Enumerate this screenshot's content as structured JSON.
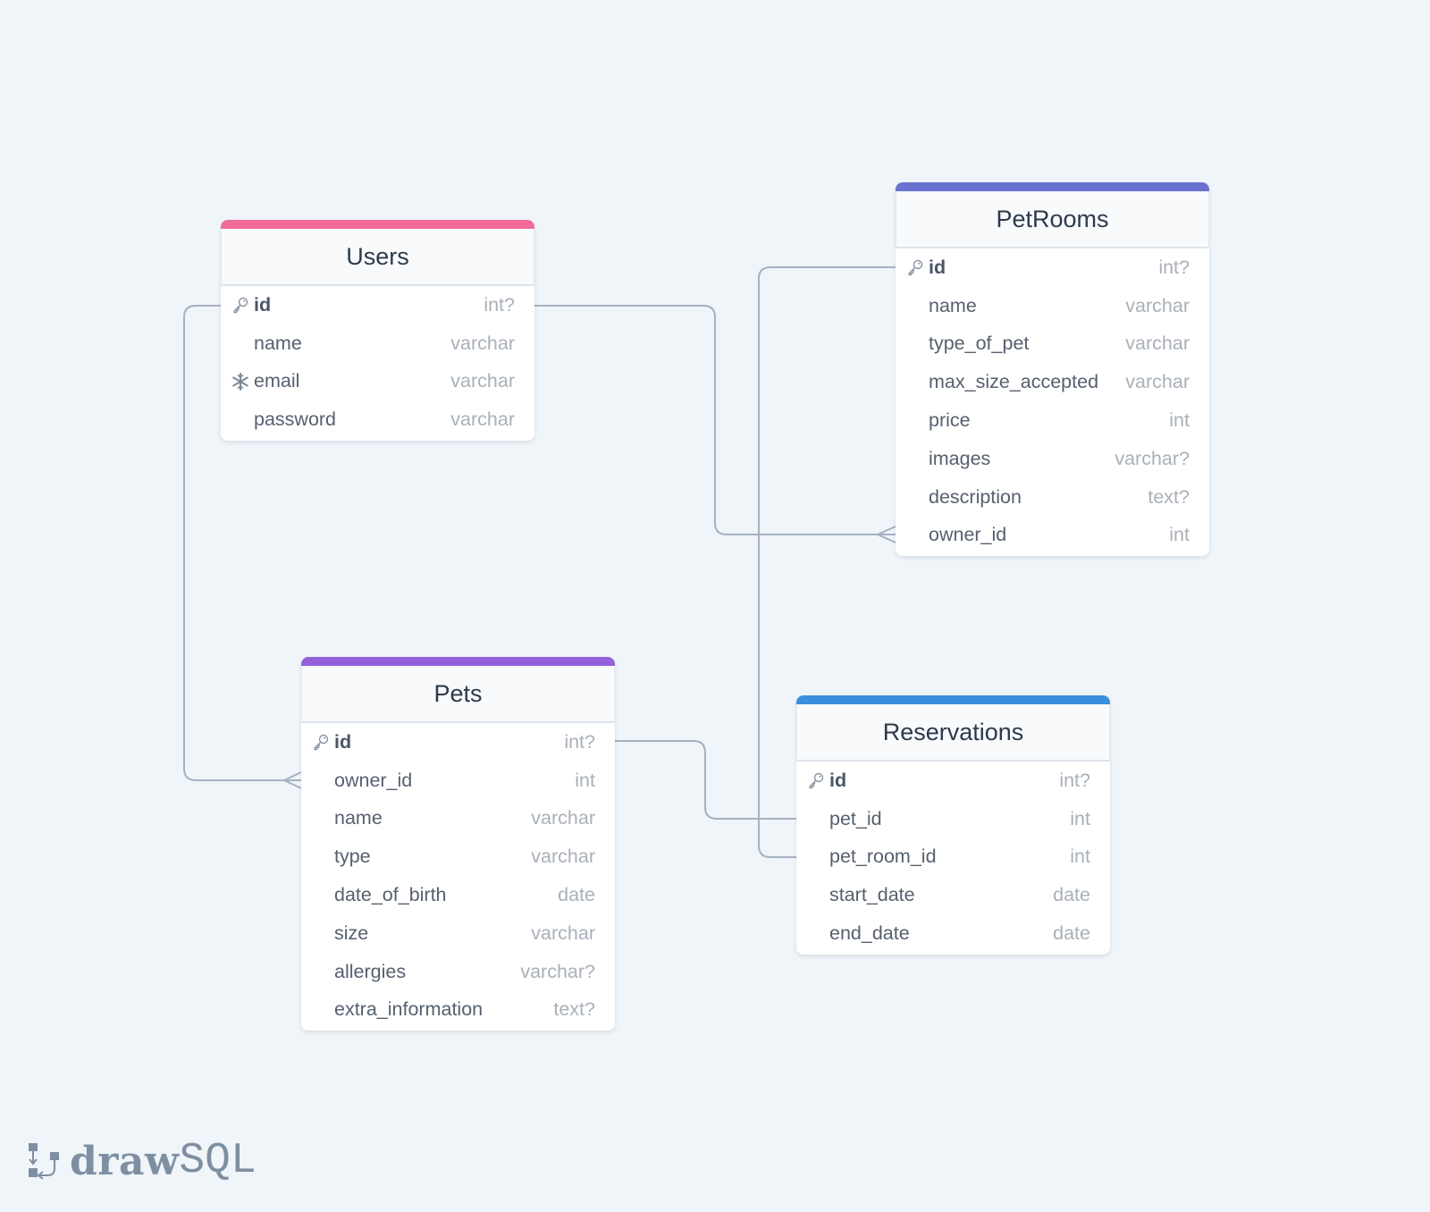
{
  "canvas": {
    "background": "#f0f5f9"
  },
  "tables": {
    "users": {
      "name": "Users",
      "color": "#f06b97",
      "fields": [
        {
          "name": "id",
          "type": "int?",
          "icon": "key-icon",
          "pk": true
        },
        {
          "name": "name",
          "type": "varchar",
          "icon": null,
          "pk": false
        },
        {
          "name": "email",
          "type": "varchar",
          "icon": "unique-snowflake-icon",
          "pk": false
        },
        {
          "name": "password",
          "type": "varchar",
          "icon": null,
          "pk": false
        }
      ]
    },
    "petrooms": {
      "name": "PetRooms",
      "color": "#6a72d0",
      "fields": [
        {
          "name": "id",
          "type": "int?",
          "icon": "key-icon",
          "pk": true
        },
        {
          "name": "name",
          "type": "varchar",
          "icon": null,
          "pk": false
        },
        {
          "name": "type_of_pet",
          "type": "varchar",
          "icon": null,
          "pk": false
        },
        {
          "name": "max_size_accepted",
          "type": "varchar",
          "icon": null,
          "pk": false
        },
        {
          "name": "price",
          "type": "int",
          "icon": null,
          "pk": false
        },
        {
          "name": "images",
          "type": "varchar?",
          "icon": null,
          "pk": false
        },
        {
          "name": "description",
          "type": "text?",
          "icon": null,
          "pk": false
        },
        {
          "name": "owner_id",
          "type": "int",
          "icon": null,
          "pk": false
        }
      ]
    },
    "pets": {
      "name": "Pets",
      "color": "#9461db",
      "fields": [
        {
          "name": "id",
          "type": "int?",
          "icon": "key-icon",
          "pk": true
        },
        {
          "name": "owner_id",
          "type": "int",
          "icon": null,
          "pk": false
        },
        {
          "name": "name",
          "type": "varchar",
          "icon": null,
          "pk": false
        },
        {
          "name": "type",
          "type": "varchar",
          "icon": null,
          "pk": false
        },
        {
          "name": "date_of_birth",
          "type": "date",
          "icon": null,
          "pk": false
        },
        {
          "name": "size",
          "type": "varchar",
          "icon": null,
          "pk": false
        },
        {
          "name": "allergies",
          "type": "varchar?",
          "icon": null,
          "pk": false
        },
        {
          "name": "extra_information",
          "type": "text?",
          "icon": null,
          "pk": false
        }
      ]
    },
    "reservations": {
      "name": "Reservations",
      "color": "#3a8fdc",
      "fields": [
        {
          "name": "id",
          "type": "int?",
          "icon": "key-icon",
          "pk": true
        },
        {
          "name": "pet_id",
          "type": "int",
          "icon": null,
          "pk": false
        },
        {
          "name": "pet_room_id",
          "type": "int",
          "icon": null,
          "pk": false
        },
        {
          "name": "start_date",
          "type": "date",
          "icon": null,
          "pk": false
        },
        {
          "name": "end_date",
          "type": "date",
          "icon": null,
          "pk": false
        }
      ]
    }
  },
  "relations": [
    {
      "from": "users.id",
      "to": "petrooms.owner_id",
      "cardinality": "one-to-many"
    },
    {
      "from": "users.id",
      "to": "pets.owner_id",
      "cardinality": "one-to-many"
    },
    {
      "from": "pets.id",
      "to": "reservations.pet_id",
      "cardinality": "one-to-one"
    },
    {
      "from": "petrooms.id",
      "to": "reservations.pet_room_id",
      "cardinality": "one-to-one"
    }
  ],
  "logo": {
    "brand_bold": "draw",
    "brand_light": "SQL",
    "icon": "drawsql-logo-icon"
  }
}
